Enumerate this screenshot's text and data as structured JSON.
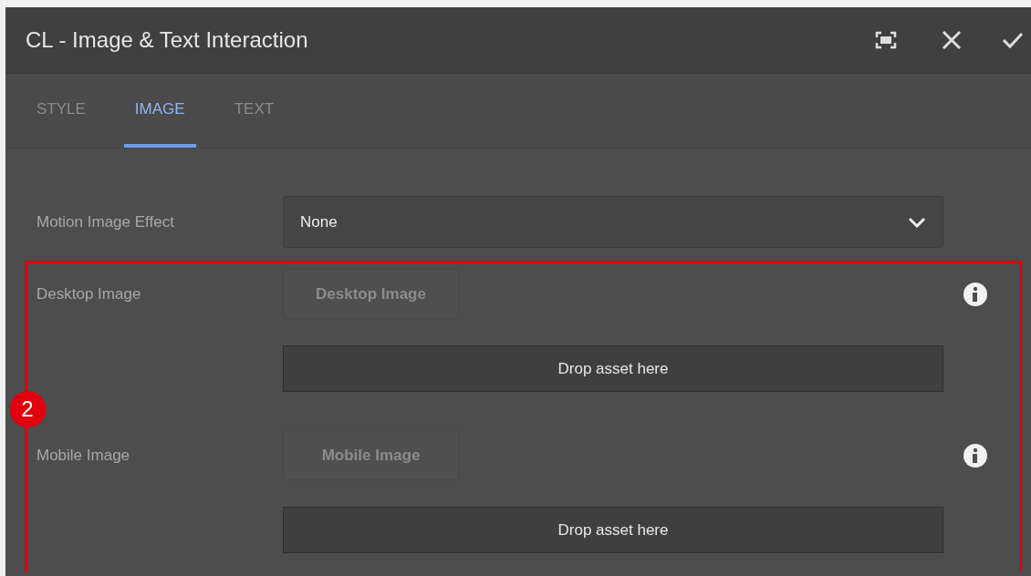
{
  "window": {
    "title": "CL - Image & Text Interaction"
  },
  "tabs": [
    {
      "label": "STYLE",
      "selected": false
    },
    {
      "label": "IMAGE",
      "selected": true
    },
    {
      "label": "TEXT",
      "selected": false
    }
  ],
  "motion_effect": {
    "label": "Motion Image Effect",
    "value": "None"
  },
  "image_fields": [
    {
      "label": "Desktop Image",
      "button": "Desktop Image",
      "disabled": true,
      "drop_zone": "Drop asset here"
    },
    {
      "label": "Mobile Image",
      "button": "Mobile Image",
      "disabled": true,
      "drop_zone": "Drop asset here"
    }
  ],
  "annotation": {
    "badge": "2"
  }
}
